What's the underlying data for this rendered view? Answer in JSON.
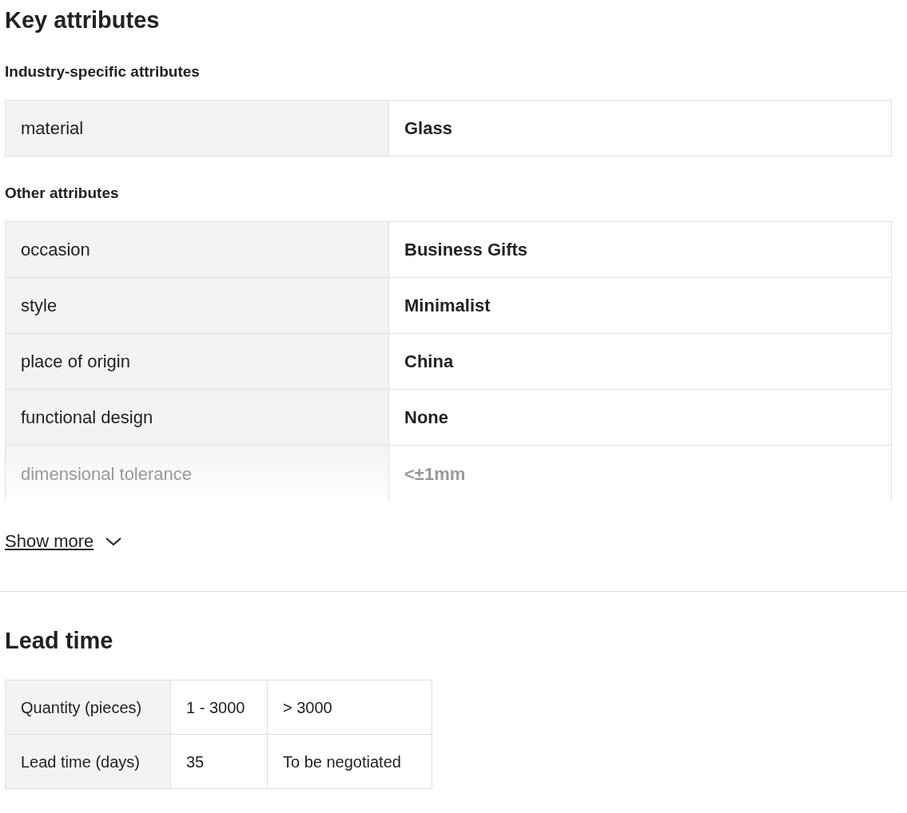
{
  "key_attributes": {
    "title": "Key attributes",
    "groups": [
      {
        "title": "Industry-specific attributes",
        "rows": [
          {
            "name": "material",
            "value": "Glass"
          }
        ]
      },
      {
        "title": "Other attributes",
        "rows": [
          {
            "name": "occasion",
            "value": "Business Gifts"
          },
          {
            "name": "style",
            "value": "Minimalist"
          },
          {
            "name": "place of origin",
            "value": "China"
          },
          {
            "name": "functional design",
            "value": "None"
          },
          {
            "name": "dimensional tolerance",
            "value": "<±1mm"
          }
        ]
      }
    ],
    "show_more": {
      "label": "Show more",
      "expanded": false
    }
  },
  "lead_time": {
    "title": "Lead time",
    "rows": [
      [
        "Quantity (pieces)",
        "1 - 3000",
        "> 3000"
      ],
      [
        "Lead time (days)",
        "35",
        "To be negotiated"
      ]
    ]
  }
}
